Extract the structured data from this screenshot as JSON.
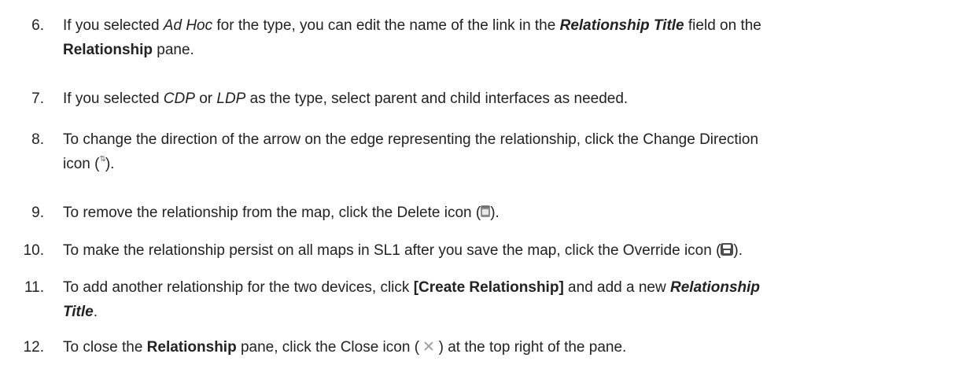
{
  "steps": [
    {
      "num": "6.",
      "t1": "If you selected ",
      "t2": "Ad Hoc",
      "t3": " for the type, you can edit the name of the link in the ",
      "t4": "Relationship Title",
      "t5": " field on the",
      "t6": "Relationship",
      "t7": " pane."
    },
    {
      "num": "7.",
      "t1": "If you selected ",
      "t2": "CDP",
      "t3": " or ",
      "t4": "LDP",
      "t5": " as the type, select parent and child interfaces as needed."
    },
    {
      "num": "8.",
      "t1": "To change the direction of the arrow on the edge representing the relationship, click the Change Direction",
      "t2": "icon (",
      "icon": "change-direction-icon",
      "icon_glyph": "⇅",
      "t3": ")."
    },
    {
      "num": "9.",
      "t1": "To remove the relationship from the map, click the Delete icon (",
      "icon": "delete-icon",
      "t2": ")."
    },
    {
      "num": "10.",
      "t1": "To make the relationship persist on all maps in SL1 after you save the map, click the Override icon (",
      "icon": "override-icon",
      "t2": ")."
    },
    {
      "num": "11.",
      "t1": "To add another relationship for the two devices, click ",
      "t2": "[Create Relationship]",
      "t3": " and add a new ",
      "t4": "Relationship",
      "t5": "Title",
      "t6": "."
    },
    {
      "num": "12.",
      "t1": "To close the ",
      "t2": "Relationship",
      "t3": " pane, click the Close icon ( ",
      "icon": "close-icon",
      "t4": " ) at the top right of the pane."
    }
  ]
}
